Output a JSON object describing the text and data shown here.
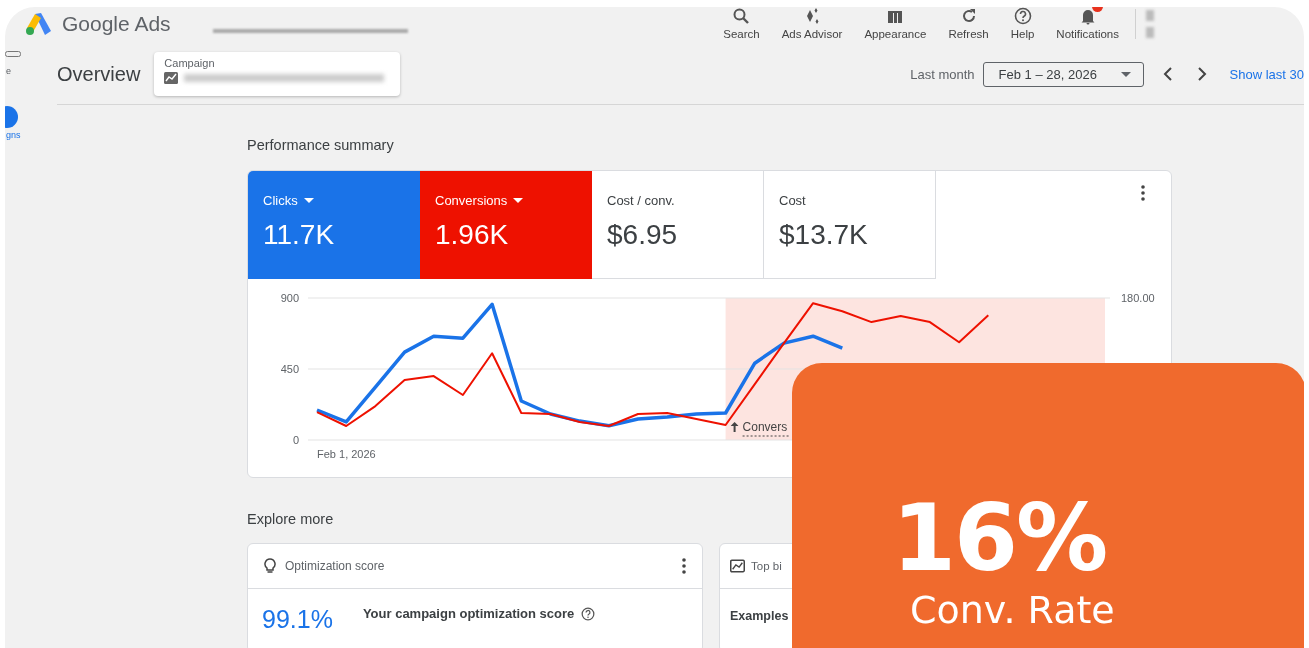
{
  "app": {
    "product_name": "Google Ads"
  },
  "toolbar": [
    {
      "label": "Search",
      "badge": false
    },
    {
      "label": "Ads Advisor",
      "badge": false
    },
    {
      "label": "Appearance",
      "badge": false
    },
    {
      "label": "Refresh",
      "badge": false
    },
    {
      "label": "Help",
      "badge": false
    },
    {
      "label": "Notifications",
      "badge": true
    }
  ],
  "sidebar": {
    "items": [
      {
        "label": "e",
        "selected": false
      },
      {
        "label": "gns",
        "selected": true
      }
    ]
  },
  "header": {
    "title": "Overview",
    "campaign_picker": {
      "label": "Campaign"
    },
    "date_range": {
      "preset": "Last month",
      "value": "Feb 1 – 28, 2026"
    },
    "link": "Show last 30"
  },
  "performance_summary": {
    "title": "Performance summary",
    "metrics": [
      {
        "label": "Clicks",
        "value": "11.7K",
        "selected": true,
        "color": "#1a73e8"
      },
      {
        "label": "Conversions",
        "value": "1.96K",
        "selected": true,
        "color": "#ee1100"
      },
      {
        "label": "Cost / conv.",
        "value": "$6.95",
        "selected": false
      },
      {
        "label": "Cost",
        "value": "$13.7K",
        "selected": false
      }
    ],
    "right_axis_label": "180.00",
    "start_date_label": "Feb 1, 2026",
    "chart_data": {
      "type": "line",
      "yticks": [
        0,
        450,
        900
      ],
      "ylim": [
        0,
        900
      ],
      "series": [
        {
          "color": "#1a73e8",
          "values": [
            190,
            115,
            335,
            557,
            658,
            645,
            860,
            247,
            165,
            120,
            90,
            133,
            146,
            165,
            171,
            487,
            614,
            658,
            582,
            null,
            null,
            null,
            null,
            null,
            null,
            null,
            null,
            null
          ]
        },
        {
          "color": "#ee1100",
          "values": [
            177,
            89,
            215,
            380,
            405,
            285,
            550,
            171,
            165,
            114,
            89,
            165,
            171,
            133,
            95,
            354,
            614,
            867,
            816,
            747,
            785,
            747,
            620,
            791,
            null,
            null,
            null,
            null
          ]
        }
      ],
      "annotations": [
        {
          "text": "Convers"
        }
      ]
    }
  },
  "explore_more": {
    "title": "Explore more",
    "cards": [
      {
        "kind": "score",
        "title": "Optimization score",
        "value": "99.1%",
        "description": "Your campaign optimization score"
      },
      {
        "kind": "chart",
        "title": "Top bi",
        "description": "Examples"
      }
    ]
  },
  "highlight": {
    "value": "16%",
    "label": "Conv. Rate"
  }
}
